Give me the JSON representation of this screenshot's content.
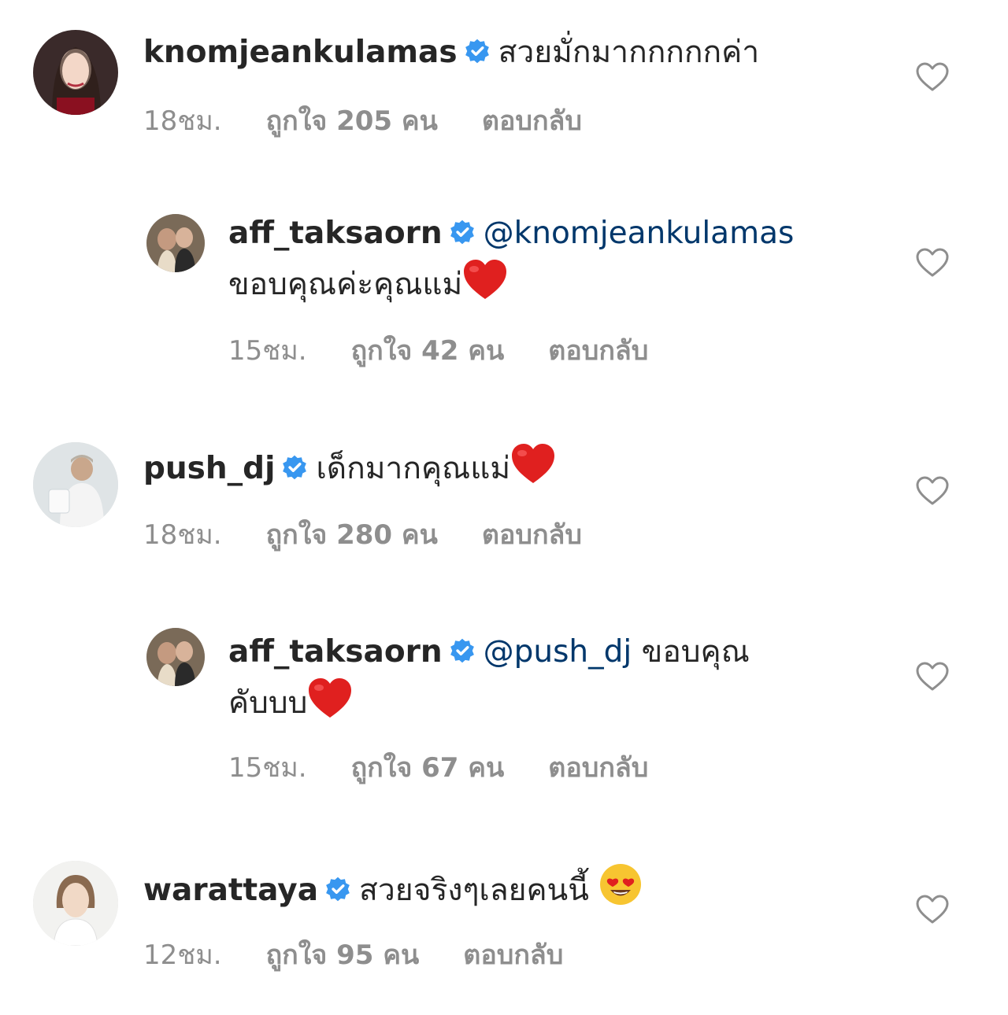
{
  "comments": [
    {
      "username": "knomjeankulamas",
      "mention": "",
      "text": "สวยมั่กมากกกกกค่า",
      "text2": "",
      "time": "18ชม.",
      "likes": "ถูกใจ 205 คน",
      "reply": "ตอบกลับ",
      "has_heart_emoji": false
    },
    {
      "username": "aff_taksaorn",
      "mention": "@knomjeankulamas",
      "text": "",
      "text2": "ขอบคุณค่ะคุณแม่",
      "time": "15ชม.",
      "likes": "ถูกใจ 42 คน",
      "reply": "ตอบกลับ",
      "has_heart_emoji": true
    },
    {
      "username": "push_dj",
      "mention": "",
      "text": "เด็กมากคุณแม่",
      "text2": "",
      "time": "18ชม.",
      "likes": "ถูกใจ 280 คน",
      "reply": "ตอบกลับ",
      "has_heart_emoji": true
    },
    {
      "username": "aff_taksaorn",
      "mention": "@push_dj",
      "text": "ขอบคุณ",
      "text2": "คับบบ",
      "time": "15ชม.",
      "likes": "ถูกใจ 67 คน",
      "reply": "ตอบกลับ",
      "has_heart_emoji": true
    },
    {
      "username": "warattaya",
      "mention": "",
      "text": "สวยจริงๆเลยคนนี้",
      "text2": "",
      "time": "12ชม.",
      "likes": "ถูกใจ 95 คน",
      "reply": "ตอบกลับ",
      "has_heart_emoji": false,
      "emoji": "heart-eyes-emoji"
    }
  ],
  "colors": {
    "verified": "#3897f0",
    "mention": "#00376b",
    "meta": "#8e8e8e",
    "heart_emoji": "#e0201f"
  },
  "icons": {
    "verified": "verified-badge-icon",
    "like": "heart-outline-icon"
  }
}
